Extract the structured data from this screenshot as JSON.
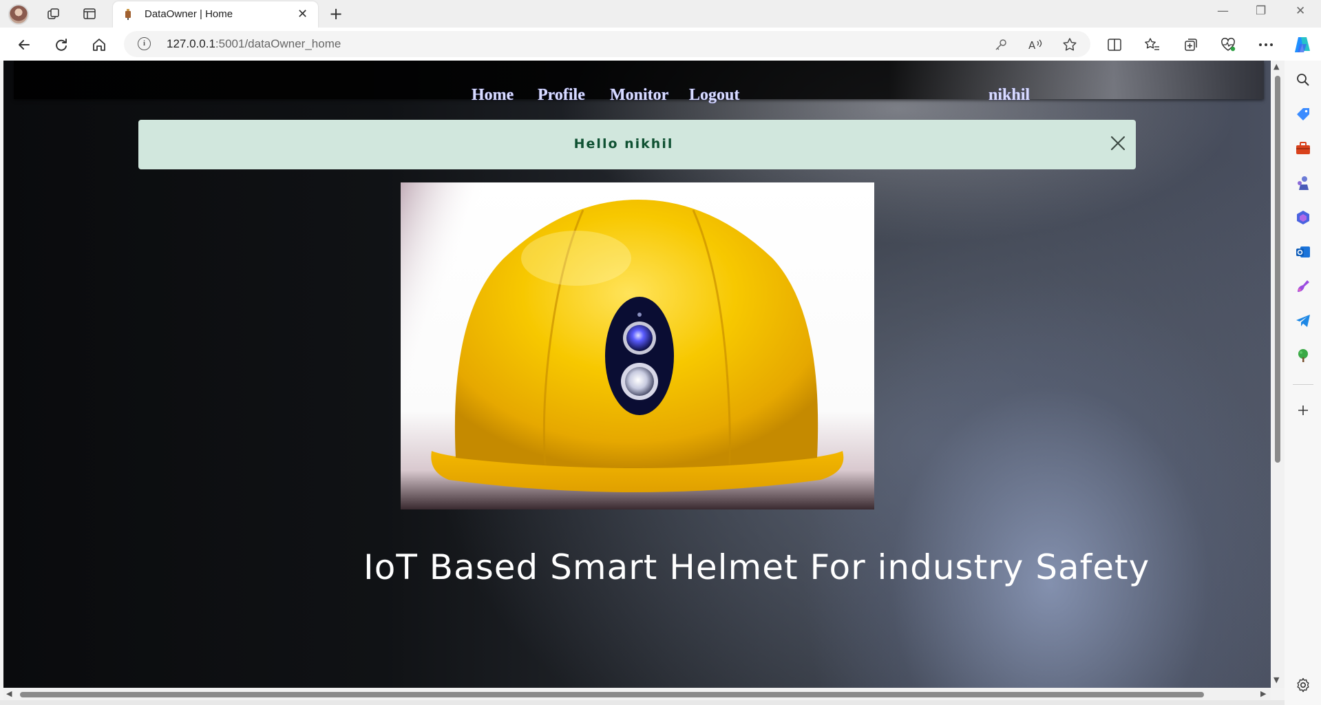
{
  "browser": {
    "tab": {
      "title": "DataOwner | Home",
      "close": "✕"
    },
    "new_tab": "+",
    "address": {
      "host": "127.0.0.1",
      "path": ":5001/dataOwner_home"
    },
    "window": {
      "minimize": "—",
      "restore": "❐",
      "close": "✕"
    }
  },
  "site": {
    "nav": {
      "home": "Home",
      "profile": "Profile",
      "monitor": "Monitor",
      "logout": "Logout",
      "username": "nikhil"
    },
    "alert": {
      "message": "Hello nikhil"
    },
    "headline": "IoT Based Smart Helmet For industry Safety"
  },
  "colors": {
    "alert_bg": "#d1e7dd",
    "alert_text": "#0f5132",
    "nav_link": "#d9dcff",
    "helmet_yellow": "#f5c400"
  },
  "icons": [
    "avatar",
    "workspaces-icon",
    "tab-actions-icon",
    "back-icon",
    "refresh-icon",
    "home-icon",
    "info-icon",
    "password-key-icon",
    "read-aloud-icon",
    "favorite-star-icon",
    "split-screen-icon",
    "favorites-icon",
    "collections-icon",
    "performance-icon",
    "more-icon",
    "copilot-icon",
    "search-icon",
    "shopping-icon",
    "tools-icon",
    "games-icon",
    "microsoft365-icon",
    "outlook-icon",
    "designer-icon",
    "telegram-icon",
    "tree-icon",
    "add-icon",
    "settings-icon"
  ]
}
